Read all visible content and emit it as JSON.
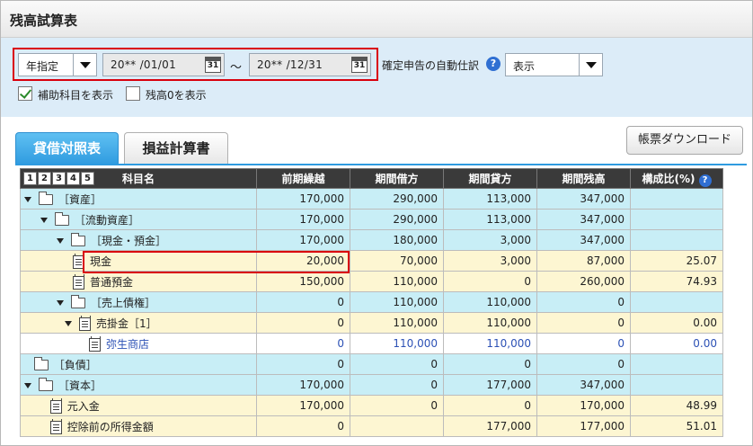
{
  "window": {
    "title": "残高試算表"
  },
  "filter": {
    "period_type": "年指定",
    "date_from": "20** /01/01",
    "date_to": "20** /12/31",
    "tilde": "～",
    "calendar_day": "31",
    "auto_journal_label": "確定申告の自動仕訳",
    "auto_journal_value": "表示",
    "show_sub_accounts_label": "補助科目を表示",
    "show_sub_accounts_checked": true,
    "show_zero_label": "残高0を表示",
    "show_zero_checked": false
  },
  "tabs": [
    {
      "label": "貸借対照表",
      "active": true
    },
    {
      "label": "損益計算書",
      "active": false
    }
  ],
  "download_button": "帳票ダウンロード",
  "table": {
    "level_buttons": [
      "1",
      "2",
      "3",
      "4",
      "5"
    ],
    "columns": [
      "科目名",
      "前期繰越",
      "期間借方",
      "期間貸方",
      "期間残高",
      "構成比(%)"
    ],
    "rows": [
      {
        "name": "［資産］",
        "prev": "170,000",
        "debit": "290,000",
        "credit": "113,000",
        "balance": "347,000",
        "ratio": "",
        "indent": 0,
        "icon": "folder",
        "expand": true,
        "style": "c"
      },
      {
        "name": "［流動資産］",
        "prev": "170,000",
        "debit": "290,000",
        "credit": "113,000",
        "balance": "347,000",
        "ratio": "",
        "indent": 1,
        "icon": "folder",
        "expand": true,
        "style": "c"
      },
      {
        "name": "［現金・預金］",
        "prev": "170,000",
        "debit": "180,000",
        "credit": "3,000",
        "balance": "347,000",
        "ratio": "",
        "indent": 2,
        "icon": "folder",
        "expand": true,
        "style": "c"
      },
      {
        "name": "現金",
        "prev": "20,000",
        "debit": "70,000",
        "credit": "3,000",
        "balance": "87,000",
        "ratio": "25.07",
        "indent": 3,
        "icon": "doc",
        "expand": false,
        "style": "y"
      },
      {
        "name": "普通預金",
        "prev": "150,000",
        "debit": "110,000",
        "credit": "0",
        "balance": "260,000",
        "ratio": "74.93",
        "indent": 3,
        "icon": "doc",
        "expand": false,
        "style": "y"
      },
      {
        "name": "［売上債権］",
        "prev": "0",
        "debit": "110,000",
        "credit": "110,000",
        "balance": "0",
        "ratio": "",
        "indent": 2,
        "icon": "folder",
        "expand": true,
        "style": "c"
      },
      {
        "name": "売掛金［1］",
        "prev": "0",
        "debit": "110,000",
        "credit": "110,000",
        "balance": "0",
        "ratio": "0.00",
        "indent": 2.5,
        "icon": "doc",
        "expand": true,
        "style": "y"
      },
      {
        "name": "弥生商店",
        "prev": "0",
        "debit": "110,000",
        "credit": "110,000",
        "balance": "0",
        "ratio": "0.00",
        "indent": 4,
        "icon": "doc",
        "expand": false,
        "style": "w"
      },
      {
        "name": "［負債］",
        "prev": "0",
        "debit": "0",
        "credit": "0",
        "balance": "0",
        "ratio": "",
        "indent": 0.6,
        "icon": "folder",
        "expand": false,
        "style": "c"
      },
      {
        "name": "［資本］",
        "prev": "170,000",
        "debit": "0",
        "credit": "177,000",
        "balance": "347,000",
        "ratio": "",
        "indent": 0,
        "icon": "folder",
        "expand": true,
        "style": "c"
      },
      {
        "name": "元入金",
        "prev": "170,000",
        "debit": "0",
        "credit": "0",
        "balance": "170,000",
        "ratio": "48.99",
        "indent": 1.6,
        "icon": "doc",
        "expand": false,
        "style": "y"
      },
      {
        "name": "控除前の所得金額",
        "prev": "0",
        "debit": "",
        "credit": "177,000",
        "balance": "177,000",
        "ratio": "51.01",
        "indent": 1.6,
        "icon": "doc",
        "expand": false,
        "style": "y"
      }
    ]
  }
}
